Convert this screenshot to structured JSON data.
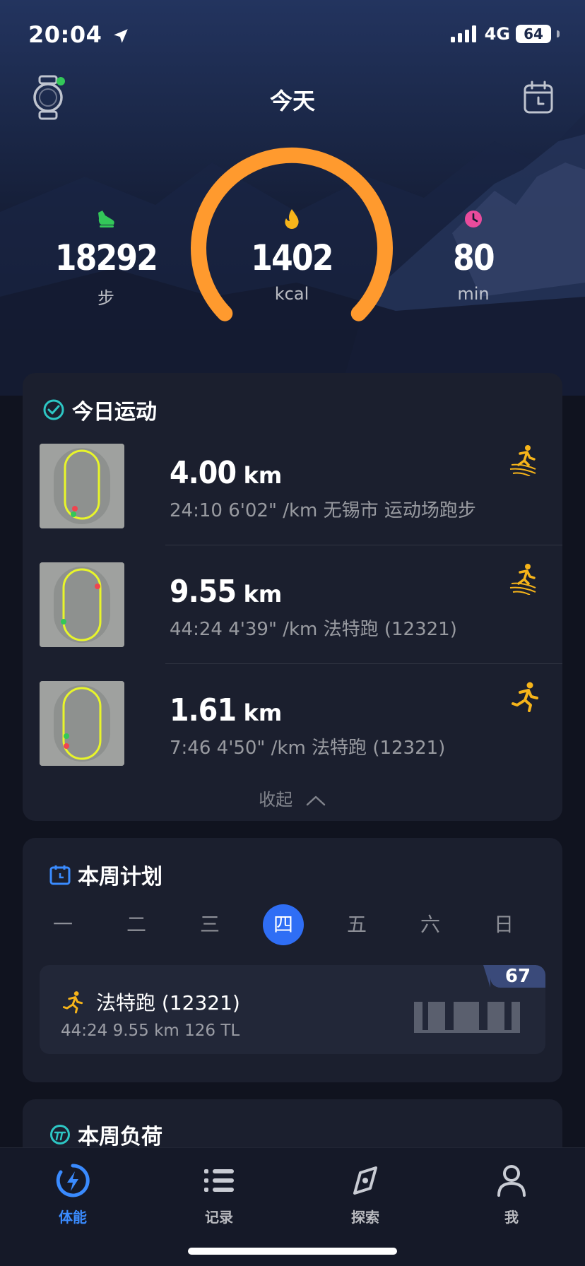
{
  "status_bar": {
    "time": "20:04",
    "network": "4G",
    "battery": "64"
  },
  "header": {
    "title": "今天"
  },
  "stats": {
    "steps": {
      "value": "18292",
      "unit": "步"
    },
    "calories": {
      "value": "1402",
      "unit": "kcal"
    },
    "minutes": {
      "value": "80",
      "unit": "min"
    },
    "gauge_fill_fraction": 1.0
  },
  "today": {
    "title": "今日运动",
    "workouts": [
      {
        "distance": "4.00",
        "unit": "km",
        "meta": "24:10  6'02\" /km 无锡市 运动场跑步",
        "sport_icon": "track-run-icon"
      },
      {
        "distance": "9.55",
        "unit": "km",
        "meta": "44:24  4'39\" /km 法特跑 (12321)",
        "sport_icon": "track-run-icon"
      },
      {
        "distance": "1.61",
        "unit": "km",
        "meta": "7:46  4'50\" /km 法特跑 (12321)",
        "sport_icon": "run-icon"
      }
    ],
    "collapse_label": "收起"
  },
  "plan": {
    "title": "本周计划",
    "weekdays": [
      "一",
      "二",
      "三",
      "四",
      "五",
      "六",
      "日"
    ],
    "active_day": "四",
    "item": {
      "name": "法特跑 (12321)",
      "meta": "44:24  9.55 km  126 TL",
      "score": "67"
    }
  },
  "load": {
    "title": "本周负荷"
  },
  "tabs": [
    {
      "label": "体能",
      "icon": "lightning-icon",
      "active": true
    },
    {
      "label": "记录",
      "icon": "list-icon",
      "active": false
    },
    {
      "label": "探索",
      "icon": "compass-icon",
      "active": false
    },
    {
      "label": "我",
      "icon": "profile-icon",
      "active": false
    }
  ],
  "colors": {
    "accent": "#ff9a2e",
    "active_blue": "#2f6ef5",
    "tab_active": "#3a8bff",
    "steps_green": "#33c759",
    "minutes_pink": "#e94b9c",
    "check_teal": "#2dc6c4"
  }
}
